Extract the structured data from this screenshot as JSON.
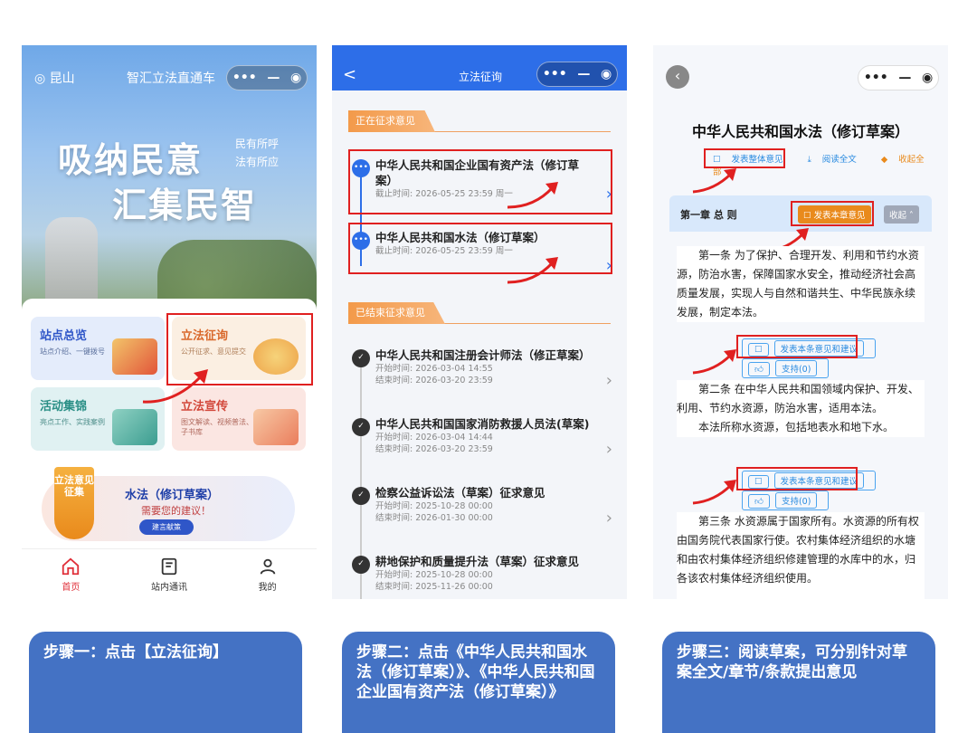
{
  "phone1": {
    "capsule": "•••  —  ◉",
    "location": "昆山",
    "title": "智汇立法直通车",
    "slogan_line1": "吸纳民意",
    "slogan_line2": "汇集民智",
    "slogan_sub1": "民有所呼",
    "slogan_sub2": "法有所应",
    "tiles": [
      {
        "title": "站点总览",
        "sub": "站点介绍、一键拨号"
      },
      {
        "title": "立法征询",
        "sub": "公开征求、意见提交"
      },
      {
        "title": "活动集锦",
        "sub": "亮点工作、实践案例"
      },
      {
        "title": "立法宣传",
        "sub": "图文解读、视频普法、电子书库"
      }
    ],
    "banner": {
      "badge": "立法意见征集",
      "title": "水法（修订草案）",
      "subtitle": "需要您的建议！",
      "button": "建言献策"
    },
    "tabs": [
      {
        "label": "首页"
      },
      {
        "label": "站内通讯"
      },
      {
        "label": "我的"
      }
    ]
  },
  "phone2": {
    "title": "立法征询",
    "back": "<",
    "ongoing_header": "正在征求意见",
    "ongoing": [
      {
        "name": "中华人民共和国企业国有资产法（修订草案）",
        "meta": "截止时间: 2026-05-25 23:59 周一"
      },
      {
        "name": "中华人民共和国水法（修订草案）",
        "meta": "截止时间: 2026-05-25 23:59 周一"
      }
    ],
    "ended_header": "已结束征求意见",
    "ended": [
      {
        "name": "中华人民共和国注册会计师法（修正草案）",
        "start": "开始时间: 2026-03-04 14:55",
        "end": "结束时间: 2026-03-20 23:59"
      },
      {
        "name": "中华人民共和国国家消防救援人员法(草案)",
        "start": "开始时间: 2026-03-04 14:44",
        "end": "结束时间: 2026-03-20 23:59"
      },
      {
        "name": "检察公益诉讼法（草案）征求意见",
        "start": "开始时间: 2025-10-28 00:00",
        "end": "结束时间: 2026-01-30 00:00"
      },
      {
        "name": "耕地保护和质量提升法（草案）征求意见",
        "start": "开始时间: 2025-10-28 00:00",
        "end": "结束时间: 2025-11-26 00:00"
      }
    ]
  },
  "phone3": {
    "title": "中华人民共和国水法（修订草案）",
    "actions": {
      "overall": "发表整体意见",
      "read": "阅读全文",
      "collect": "收起全部"
    },
    "chapter": {
      "title": "第一章 总 则",
      "comment": "发表本章意见",
      "collapse": "收起"
    },
    "articles": [
      {
        "text": "第一条 为了保护、合理开发、利用和节约水资源，防治水害，保障国家水安全，推动经济社会高质量发展，实现人与自然和谐共生、中华民族永续发展，制定本法。"
      },
      {
        "text": "第二条 在中华人民共和国领域内保护、开发、利用、节约水资源，防治水害，适用本法。",
        "text2": "本法所称水资源，包括地表水和地下水。"
      },
      {
        "text": "第三条 水资源属于国家所有。水资源的所有权由国务院代表国家行使。农村集体经济组织的水塘和由农村集体经济组织修建管理的水库中的水，归各该农村集体经济组织使用。"
      }
    ],
    "article_comment": "发表本条意见和建议",
    "support": "支持(0)"
  },
  "captions": [
    "步骤一：点击【立法征询】",
    "步骤二：点击《中华人民共和国水法（修订草案）》、《中华人民共和国企业国有资产法（修订草案）》",
    "步骤三：阅读草案，可分别针对草案全文/章节/条款提出意见"
  ],
  "colors": {
    "primary": "#2d6ee8",
    "accent": "#e98a1c",
    "highlight": "#e02020",
    "caption": "#4472c4"
  }
}
